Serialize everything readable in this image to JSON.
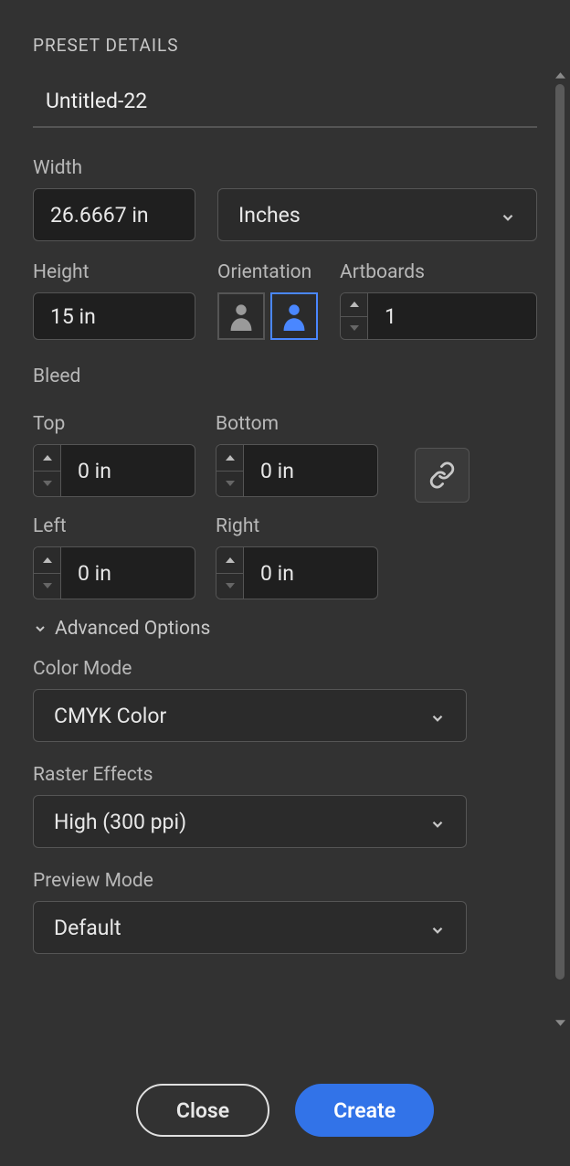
{
  "sectionTitle": "PRESET DETAILS",
  "presetName": "Untitled-22",
  "labels": {
    "width": "Width",
    "height": "Height",
    "orientation": "Orientation",
    "artboards": "Artboards",
    "bleed": "Bleed",
    "top": "Top",
    "bottom": "Bottom",
    "left": "Left",
    "right": "Right",
    "advanced": "Advanced Options",
    "colorMode": "Color Mode",
    "rasterEffects": "Raster Effects",
    "previewMode": "Preview Mode"
  },
  "width": "26.6667 in",
  "units": "Inches",
  "height": "15 in",
  "artboards": "1",
  "bleed": {
    "top": "0 in",
    "bottom": "0 in",
    "left": "0 in",
    "right": "0 in"
  },
  "colorMode": "CMYK Color",
  "rasterEffects": "High (300 ppi)",
  "previewMode": "Default",
  "buttons": {
    "close": "Close",
    "create": "Create"
  }
}
